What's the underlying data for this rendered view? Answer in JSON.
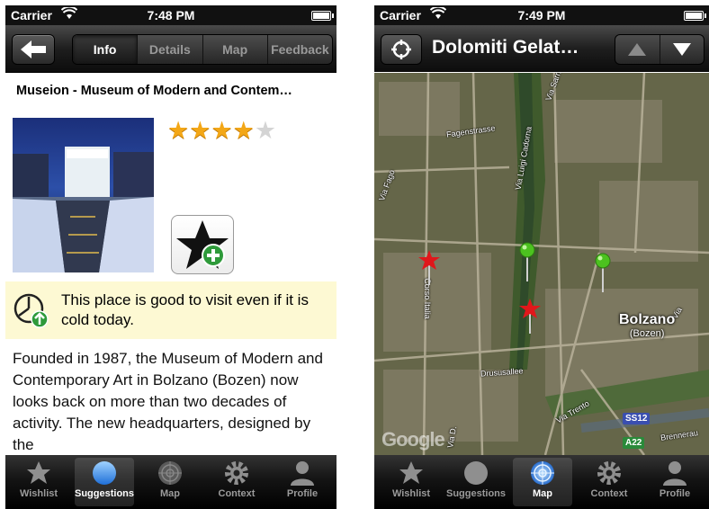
{
  "left_screen": {
    "status": {
      "carrier": "Carrier",
      "time": "7:48 PM"
    },
    "nav": {
      "back_icon": "back-arrow-icon",
      "tabs": [
        {
          "label": "Info",
          "active": true
        },
        {
          "label": "Details",
          "active": false
        },
        {
          "label": "Map",
          "active": false
        },
        {
          "label": "Feedback",
          "active": false
        }
      ]
    },
    "poi": {
      "title": "Museion - Museum of Modern and Contem…",
      "rating": 4,
      "rating_max": 5,
      "wishlist_icon": "add-to-wishlist-star-icon",
      "weather_note": "This place is good to visit even if it is cold today.",
      "description": "Founded in 1987, the Museum of Modern and Contemporary Art in Bolzano (Bozen) now looks back on more than two decades of activity. The new headquarters, designed by the"
    },
    "tabbar": [
      {
        "label": "Wishlist",
        "icon": "star-icon",
        "active": false
      },
      {
        "label": "Suggestions",
        "icon": "circle-icon",
        "active": true
      },
      {
        "label": "Map",
        "icon": "radar-icon",
        "active": false
      },
      {
        "label": "Context",
        "icon": "gear-icon",
        "active": false
      },
      {
        "label": "Profile",
        "icon": "person-icon",
        "active": false
      }
    ]
  },
  "right_screen": {
    "status": {
      "carrier": "Carrier",
      "time": "7:49 PM"
    },
    "nav": {
      "title": "Dolomiti Gelat…",
      "up_icon": "up-arrow-icon",
      "down_icon": "down-arrow-icon",
      "locate_icon": "locate-icon"
    },
    "map": {
      "street_labels": [
        "Via Sarnesi",
        "Fagenstrasse",
        "Via Luigi Cadorna",
        "Via Fago",
        "Corso Italia",
        "Drususallee",
        "Via Trento",
        "Via D.",
        "Via",
        "Brennerau"
      ],
      "city_name": "Bolzano",
      "city_alt": "(Bozen)",
      "road_signs": [
        "SS12",
        "A22"
      ],
      "watermark": "Google"
    },
    "tabbar": [
      {
        "label": "Wishlist",
        "icon": "star-icon",
        "active": false
      },
      {
        "label": "Suggestions",
        "icon": "circle-icon",
        "active": false
      },
      {
        "label": "Map",
        "icon": "radar-icon",
        "active": true
      },
      {
        "label": "Context",
        "icon": "gear-icon",
        "active": false
      },
      {
        "label": "Profile",
        "icon": "person-icon",
        "active": false
      }
    ]
  },
  "colors": {
    "star_on": "#f3a717",
    "star_off": "#d4d4d4",
    "weather_bg": "#fdf9d3",
    "pin_red": "#e0171b",
    "pin_green": "#4cc21f"
  }
}
